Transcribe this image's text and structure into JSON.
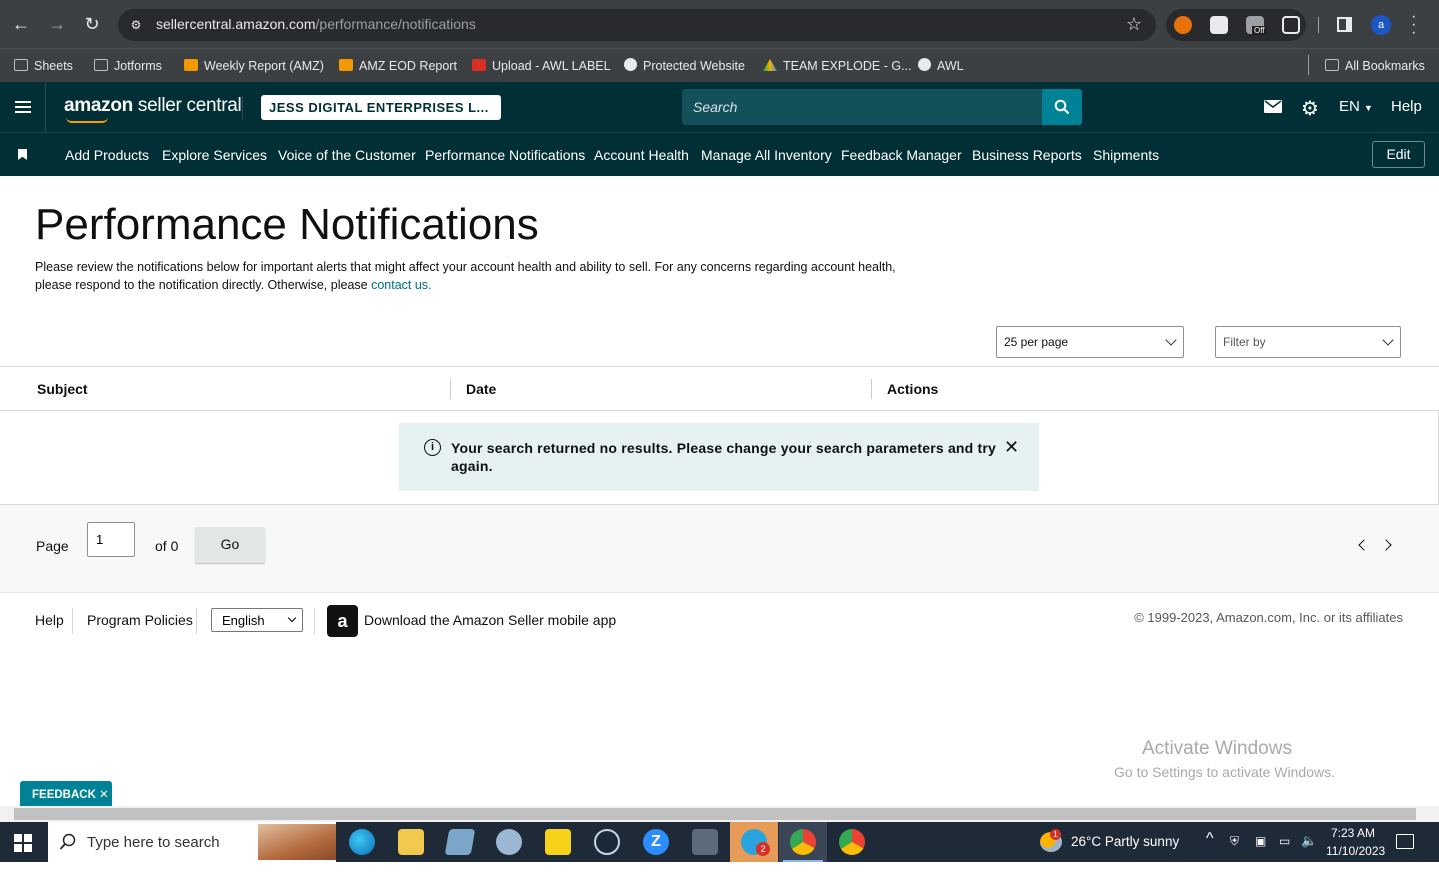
{
  "browser": {
    "url_host": "sellercentral.amazon.com",
    "url_path": "/performance/notifications",
    "bookmarks": [
      "Sheets",
      "Jotforms",
      "Weekly Report (AMZ)",
      "AMZ EOD Report",
      "Upload - AWL LABEL",
      "Protected Website",
      "TEAM EXPLODE - G...",
      "AWL"
    ],
    "all_bookmarks": "All Bookmarks",
    "profile_initial": "a",
    "ext_badge": "Off"
  },
  "header": {
    "logo_bold": "amazon",
    "logo_light": " seller central",
    "account_name": "JESS DIGITAL ENTERPRISES L...",
    "search_placeholder": "Search",
    "lang": "EN",
    "help": "Help"
  },
  "nav": {
    "items": [
      "Add Products",
      "Explore Services",
      "Voice of the Customer",
      "Performance Notifications",
      "Account Health",
      "Manage All Inventory",
      "Feedback Manager",
      "Business Reports",
      "Shipments"
    ],
    "edit": "Edit"
  },
  "page": {
    "title": "Performance Notifications",
    "desc_line1": "Please review the notifications below for important alerts that might affect your account health and ability to sell. For any concerns regarding account health,",
    "desc_line2": "please respond to the notification directly. Otherwise, please ",
    "contact_link": "contact us.",
    "per_page": "25 per page",
    "filter": "Filter by"
  },
  "table": {
    "columns": [
      "Subject",
      "Date",
      "Actions"
    ],
    "empty_message": "Your search returned no results. Please change your search parameters and try again."
  },
  "pager": {
    "page_label": "Page",
    "page_value": "1",
    "of_label": "of 0",
    "go": "Go"
  },
  "footer": {
    "help": "Help",
    "policies": "Program Policies",
    "language": "English",
    "app_text": "Download the Amazon Seller mobile app",
    "copyright": "© 1999-2023, Amazon.com, Inc. or its affiliates"
  },
  "windows": {
    "activate_title": "Activate Windows",
    "activate_sub": "Go to Settings to activate Windows.",
    "search_placeholder": "Type here to search",
    "weather": "26°C  Partly sunny",
    "time": "7:23 AM",
    "date": "11/10/2023",
    "telegram_badge": "2",
    "weather_badge": "1"
  },
  "feedback_tab": "FEEDBACK",
  "colors": {
    "header_bg": "#002f36",
    "accent": "#008296",
    "link": "#007185",
    "alert_bg": "#e5f1f3"
  }
}
